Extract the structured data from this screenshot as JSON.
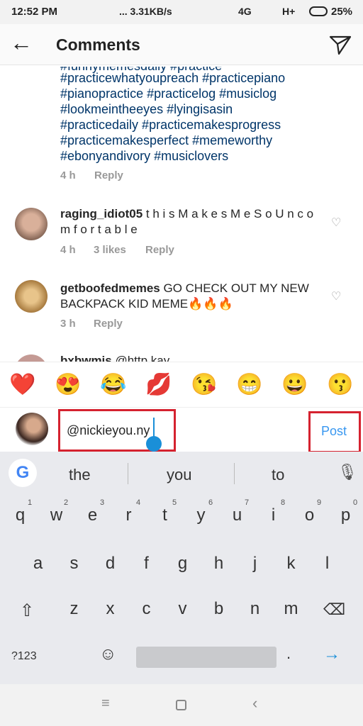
{
  "status": {
    "time": "12:52 PM",
    "speed": "... 3.31KB/s",
    "network1": "4G",
    "network2": "H+",
    "battery": "25%"
  },
  "header": {
    "title": "Comments",
    "back_icon": "arrow-left-icon",
    "share_icon": "paper-plane-icon"
  },
  "comments": [
    {
      "tags_partial": "#funnymemesdaily #practice",
      "tags": [
        "#practicewhatyoupreach #practicepiano",
        "#pianopractice #practicelog #musiclog",
        "#lookmeintheeyes #lyingisasin",
        "#practicedaily #practicemakesprogress",
        "#practicemakesperfect #memeworthy",
        "#ebonyandivory #musiclovers"
      ],
      "time": "4 h",
      "reply": "Reply"
    },
    {
      "username": "raging_idiot05",
      "text": " t h i s  M a k e s  M e  S o  U n c o m f o r t a b l e",
      "time": "4 h",
      "likes": "3 likes",
      "reply": "Reply"
    },
    {
      "username": "getboofedmemes",
      "text": " GO CHECK OUT MY NEW BACKPACK KID MEME🔥🔥🔥",
      "time": "3 h",
      "reply": "Reply"
    },
    {
      "username": "bxbwmjs",
      "text": " @http.kay"
    }
  ],
  "emojis": [
    "❤️",
    "😍",
    "😂",
    "💋",
    "😘",
    "😁",
    "😀",
    "😗"
  ],
  "input": {
    "value": "@nickieyou.ny",
    "post": "Post"
  },
  "keyboard": {
    "suggestions": [
      "the",
      "you",
      "to"
    ],
    "row1": [
      "q",
      "w",
      "e",
      "r",
      "t",
      "y",
      "u",
      "i",
      "o",
      "p"
    ],
    "hints": [
      "1",
      "2",
      "3",
      "4",
      "5",
      "6",
      "7",
      "8",
      "9",
      "0"
    ],
    "row2": [
      "a",
      "s",
      "d",
      "f",
      "g",
      "h",
      "j",
      "k",
      "l"
    ],
    "row3": [
      "z",
      "x",
      "c",
      "v",
      "b",
      "n",
      "m"
    ],
    "symbols": "?123",
    "period": "."
  }
}
